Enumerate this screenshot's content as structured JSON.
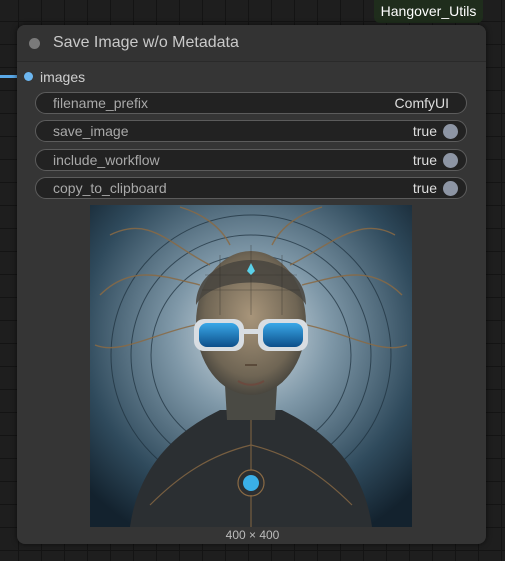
{
  "group_badge": "Hangover_Utils",
  "node": {
    "title": "Save Image w/o Metadata",
    "input": {
      "label": "images"
    },
    "widgets": [
      {
        "name": "filename_prefix",
        "value": "ComfyUI"
      },
      {
        "name": "save_image",
        "value": "true"
      },
      {
        "name": "include_workflow",
        "value": "true"
      },
      {
        "name": "copy_to_clipboard",
        "value": "true"
      }
    ],
    "preview": {
      "description_icon": "image-preview",
      "size_label": "400 × 400"
    }
  },
  "colors": {
    "canvas": "#1e1e1e",
    "node_body": "#353535",
    "widget_bg": "#222222",
    "link": "#5aa9e8",
    "badge_bg": "#1f2d1c"
  }
}
